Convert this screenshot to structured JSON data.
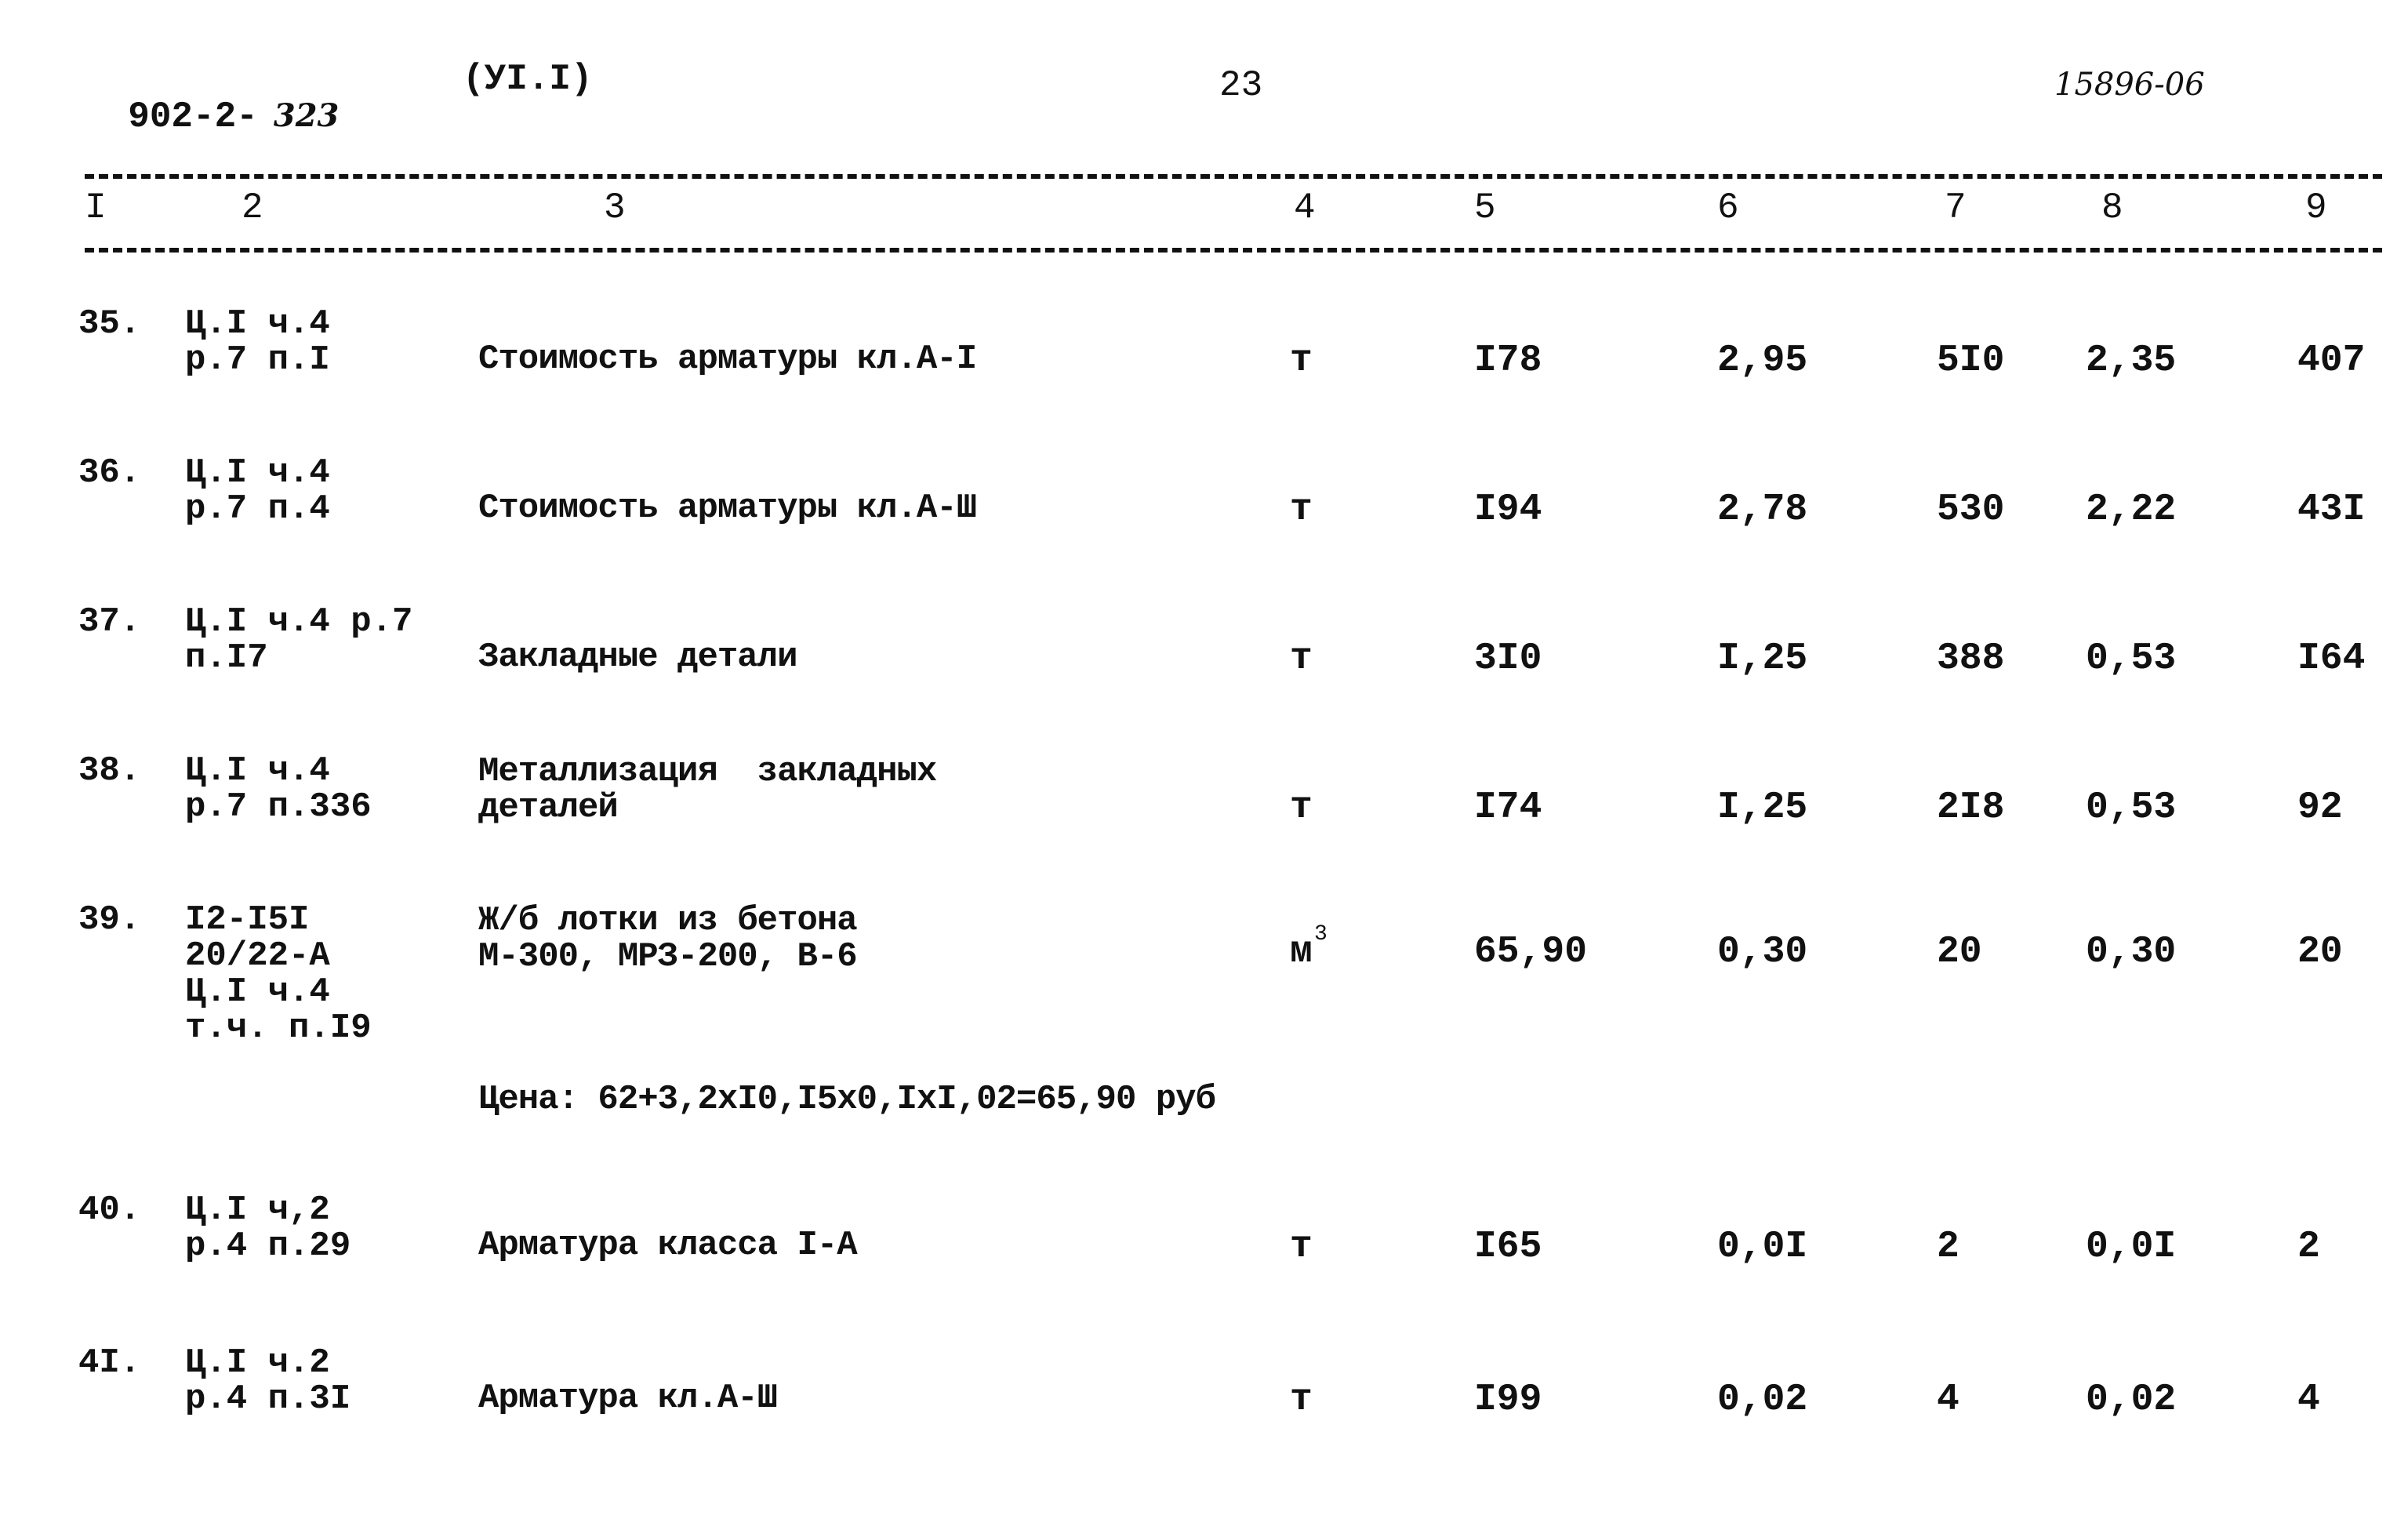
{
  "header": {
    "doc_code": "902-2-",
    "doc_code_handwritten": "323",
    "album": "(УI.I)",
    "page_number": "23",
    "inventory_handwritten": "15896-06"
  },
  "table": {
    "column_numbers": [
      "I",
      "2",
      "3",
      "4",
      "5",
      "6",
      "7",
      "8",
      "9"
    ],
    "rows": [
      {
        "no": "35.",
        "ref1": "Ц.I ч.4",
        "ref2": "р.7 п.I",
        "desc1": "",
        "desc2": "Стоимость арматуры кл.А-I",
        "unit": "т",
        "c5": "I78",
        "c6": "2,95",
        "c7": "5I0",
        "c8": "2,35",
        "c9": "407"
      },
      {
        "no": "36.",
        "ref1": "Ц.I ч.4",
        "ref2": "р.7 п.4",
        "desc1": "",
        "desc2": "Стоимость арматуры кл.А-Ш",
        "unit": "т",
        "c5": "I94",
        "c6": "2,78",
        "c7": "530",
        "c8": "2,22",
        "c9": "43I"
      },
      {
        "no": "37.",
        "ref1": "Ц.I ч.4 р.7",
        "ref2": "п.I7",
        "desc1": "",
        "desc2": "Закладные детали",
        "unit": "т",
        "c5": "3I0",
        "c6": "I,25",
        "c7": "388",
        "c8": "0,53",
        "c9": "I64"
      },
      {
        "no": "38.",
        "ref1": "Ц.I ч.4",
        "ref2": "р.7 п.336",
        "desc1": "Металлизация  закладных",
        "desc2": "деталей",
        "unit": "т",
        "c5": "I74",
        "c6": "I,25",
        "c7": "2I8",
        "c8": "0,53",
        "c9": "92"
      },
      {
        "no": "39.",
        "ref1": "I2-I5I",
        "ref2": "20/22-А",
        "ref3": "Ц.I ч.4",
        "ref4": "т.ч. п.I9",
        "desc1": "Ж/б лотки из бетона",
        "desc2": "М-300, МРЗ-200, В-6",
        "unit": "м",
        "unit_sup": "3",
        "c5": "65,90",
        "c6": "0,30",
        "c7": "20",
        "c8": "0,30",
        "c9": "20",
        "note": "Цена: 62+3,2хI0,I5х0,IхI,02=65,90 руб"
      },
      {
        "no": "40.",
        "ref1": "Ц.I ч,2",
        "ref2": "р.4 п.29",
        "desc1": "",
        "desc2": "Арматура класса I-А",
        "unit": "т",
        "c5": "I65",
        "c6": "0,0I",
        "c7": "2",
        "c8": "0,0I",
        "c9": "2"
      },
      {
        "no": "4I.",
        "ref1": "Ц.I ч.2",
        "ref2": "р.4 п.3I",
        "desc1": "",
        "desc2": "Арматура кл.А-Ш",
        "unit": "т",
        "c5": "I99",
        "c6": "0,02",
        "c7": "4",
        "c8": "0,02",
        "c9": "4"
      }
    ]
  }
}
